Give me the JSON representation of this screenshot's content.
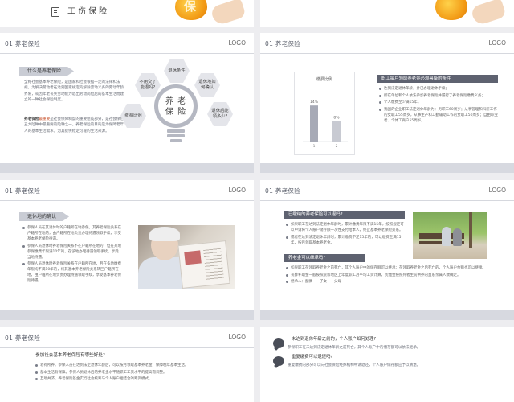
{
  "deck": {
    "logo": "LOGO",
    "section_label": "01 养老保险"
  },
  "top_banner": {
    "title": "工伤保险",
    "fruit_char": "保"
  },
  "slide1": {
    "tag": "什么是养老保险",
    "para1": "全称社会基本养老保险，是国家和社会根据一定的法律和法规，为解决劳动者在达到国家规定的解除劳动义务的劳动年龄界限，或因年老丧失劳动能力退出劳动岗位后的基本生活而建立的一种社会保险制度。",
    "para2_bold": "养老保险",
    "para2_rest": "是社会保障制度的重要组成部分，是社会保险五大险种中最重要的险种之一。养老保险的目的是为保障老年人的基本生活需求，为其提供稳定可靠的生活来源。",
    "highlight": "最重要",
    "hexes": [
      "不用交了能退吗?",
      "退休条件",
      "退休地如何确认",
      "退休后能领多少?",
      "缴费比例"
    ],
    "bulb_text": "养 老\n保 险"
  },
  "slide2": {
    "header": "职工每月领取养老金必须具备的条件",
    "bullets": [
      "达到法定退休年龄，并已办理退休手续；",
      "所在单位和个人依法参加养老保险并履行了养老保险缴费义务；",
      "个人缴费至少满15年。",
      "我国的企业职工法定退休年龄为：男职工60周岁；从事管理和科研工作的女职工55周岁，从事生产和工勤辅助工作的女职工50周岁；自由职业者、个体工商户55周岁。"
    ]
  },
  "chart_data": {
    "type": "bar",
    "title": "缴费比例",
    "categories": [
      "1",
      "2"
    ],
    "values": [
      14,
      8
    ],
    "data_labels": [
      "14%",
      "8%"
    ],
    "ylim": [
      0,
      20
    ],
    "colors": [
      "#a7aab6",
      "#c8cad2"
    ]
  },
  "slide3": {
    "tag": "退休地的确认",
    "bullets": [
      "参保人员在其退休时的户籍所在地参保，其养老保险关系在户籍所在地的，由户籍所在地负责办理待遇领取手续，享受基本养老保险待遇。",
      "参保人员退休时养老保险关系不在户籍所在地的，但在某地参保缴费年限满10年的，在该地办理待遇领取手续，享受当地待遇。",
      "参保人员退休时养老保险关系在户籍所在地，且在多地缴费年限均不满10年的，将其基本养老保险关系转回户籍所在地，由户籍所在地负责办理待遇领取手续，享受基本养老保险待遇。",
      "跨省流动就业的，由原参保所在地社会保险经办机构开具参保缴费凭证，其基本养老保险关系随同转移。"
    ]
  },
  "slide4": {
    "header1": "已缴纳的养老保险可以退吗?",
    "bullets1": [
      "如果职工在达到法定退休年龄时，累计缴费年限不满15年，按照规定可以申请将个人账户储存额一次性支付给本人，终止基本养老保险关系。",
      "或者在达到法定退休年龄时，累计缴费不足15年的，可以缴费至满15年，按月领取基本养老金。"
    ],
    "header2": "养老金可以继承吗?",
    "bullets2": [
      "如果职工在领取养老金之前死亡，其个人账户中的储存额可以继承；在领取养老金之后死亡的，个人账户余额也可以继承。",
      "丧葬补助金一般按照统筹地区上年度职工月平均工资计算，抚恤金按照死者生前供养的直系亲属人数确定。",
      "继承人：配偶——子女——父母"
    ]
  },
  "slide5": {
    "title": "参加社会基本养老保险有哪些好处?",
    "bullets": [
      "老有所养。参保人员在达到法定退休年龄后，可以按月领取基本养老金，保障晚年基本生活。",
      "基本生活有保障。参保人员退休后的养老金水平随职工工资水平的提高而调整。",
      "互助共济。养老保险基金实行社会统筹与个人账户相结合的筹资模式。"
    ]
  },
  "slide6": {
    "q1": "未达到退休年龄之前的，个人账户如何处理?",
    "a1": "参保职工在未达到法定退休年龄之前死亡，其个人账户中的储存额可以依法继承。",
    "q2": "重复缴费可以退还吗?",
    "a2": "重复缴费的部分可以向社会保险经办机构申请退还，个人账户储存额应予以清退。"
  }
}
